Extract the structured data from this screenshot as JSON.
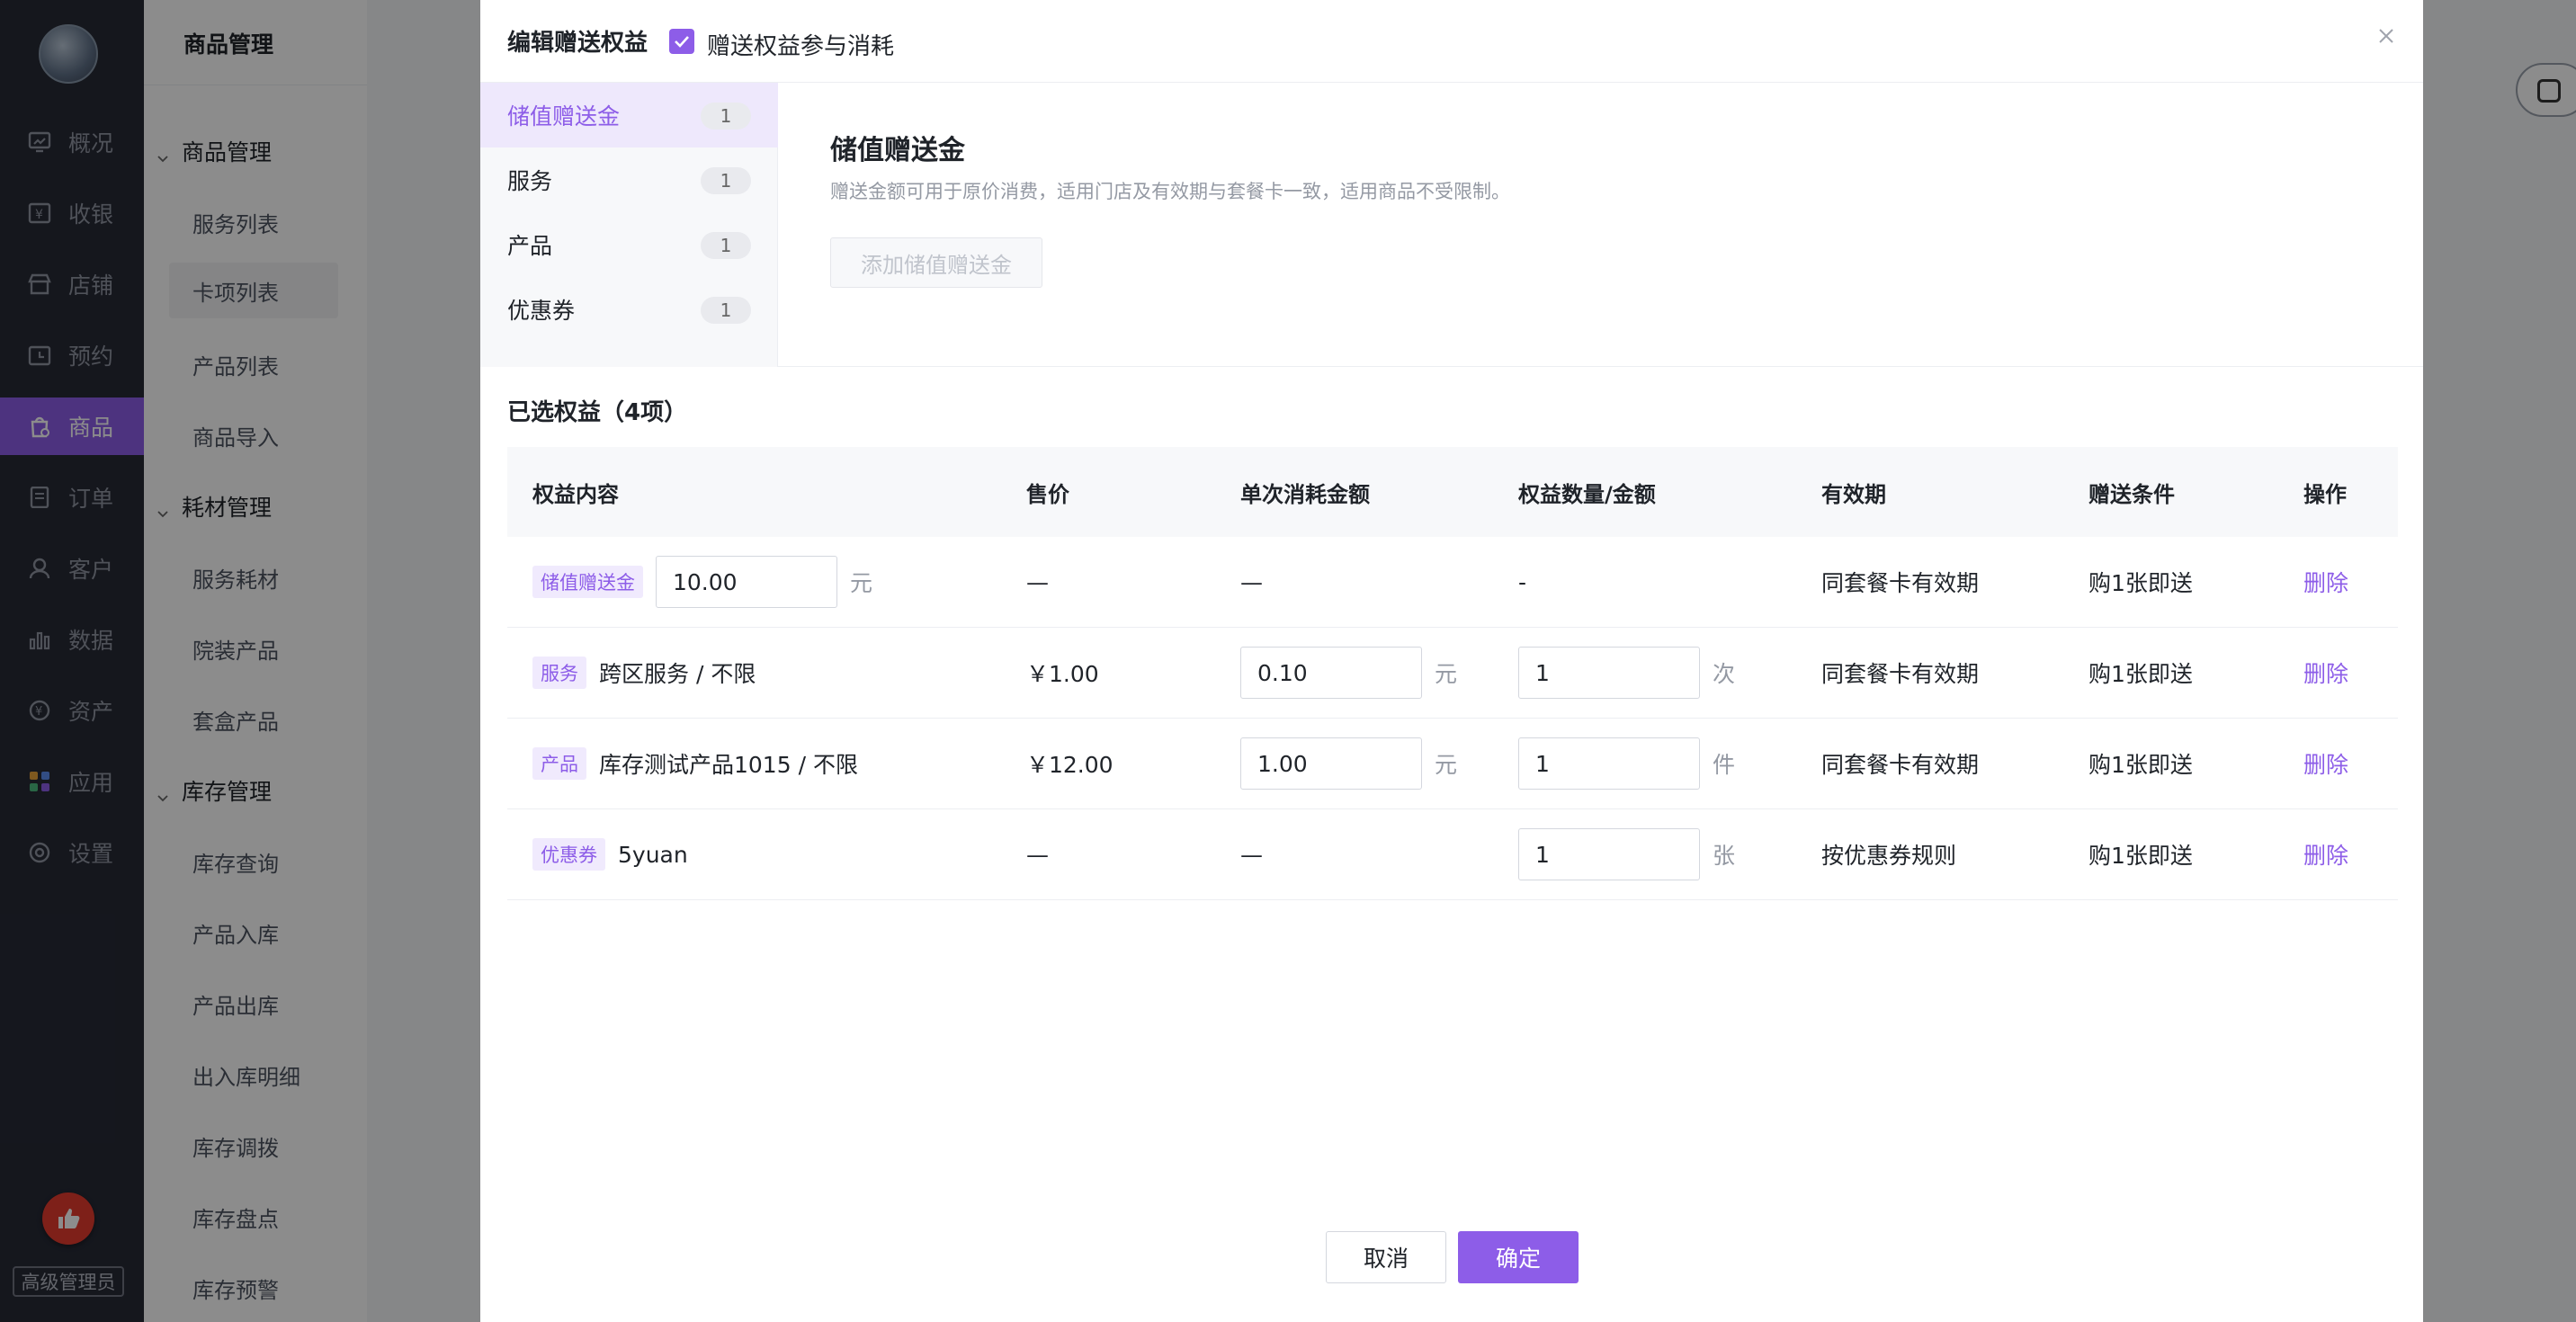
{
  "nav": {
    "items": [
      {
        "label": "概况",
        "icon": "overview-icon"
      },
      {
        "label": "收银",
        "icon": "cashier-icon"
      },
      {
        "label": "店铺",
        "icon": "store-icon"
      },
      {
        "label": "预约",
        "icon": "appointment-icon"
      },
      {
        "label": "商品",
        "icon": "goods-icon",
        "active": true
      },
      {
        "label": "订单",
        "icon": "order-icon"
      },
      {
        "label": "客户",
        "icon": "customer-icon"
      },
      {
        "label": "数据",
        "icon": "data-icon"
      },
      {
        "label": "资产",
        "icon": "asset-icon"
      },
      {
        "label": "应用",
        "icon": "apps-icon"
      },
      {
        "label": "设置",
        "icon": "settings-icon"
      }
    ],
    "role_badge": "高级管理员"
  },
  "subnav": {
    "title": "商品管理",
    "groups": [
      {
        "label": "商品管理",
        "items": [
          "服务列表",
          "卡项列表",
          "产品列表",
          "商品导入"
        ],
        "selected": "卡项列表"
      },
      {
        "label": "耗材管理",
        "items": [
          "服务耗材",
          "院装产品",
          "套盒产品"
        ]
      },
      {
        "label": "库存管理",
        "items": [
          "库存查询",
          "产品入库",
          "产品出库",
          "出入库明细",
          "库存调拨",
          "库存盘点",
          "库存预警"
        ]
      }
    ]
  },
  "modal": {
    "title": "编辑赠送权益",
    "checkbox_label": "赠送权益参与消耗",
    "checkbox_checked": true,
    "categories": [
      {
        "label": "储值赠送金",
        "count": "1",
        "active": true
      },
      {
        "label": "服务",
        "count": "1"
      },
      {
        "label": "产品",
        "count": "1"
      },
      {
        "label": "优惠券",
        "count": "1"
      }
    ],
    "detail": {
      "title": "储值赠送金",
      "desc": "赠送金额可用于原价消费，适用门店及有效期与套餐卡一致，适用商品不受限制。",
      "add_button": "添加储值赠送金"
    },
    "selected_title": "已选权益（4项）",
    "table": {
      "headers": [
        "权益内容",
        "售价",
        "单次消耗金额",
        "权益数量/金额",
        "有效期",
        "赠送条件",
        "操作"
      ],
      "rows": [
        {
          "tag": "储值赠送金",
          "name": "",
          "amount_input": "10.00",
          "amount_unit": "元",
          "price": "—",
          "per_use": "—",
          "per_use_unit": "",
          "qty": "-",
          "qty_unit": "",
          "validity": "同套餐卡有效期",
          "condition": "购1张即送",
          "action": "删除"
        },
        {
          "tag": "服务",
          "name": "跨区服务 / 不限",
          "amount_input": "",
          "amount_unit": "",
          "price": "￥1.00",
          "per_use": "0.10",
          "per_use_unit": "元",
          "qty": "1",
          "qty_unit": "次",
          "validity": "同套餐卡有效期",
          "condition": "购1张即送",
          "action": "删除"
        },
        {
          "tag": "产品",
          "name": "库存测试产品1015 / 不限",
          "amount_input": "",
          "amount_unit": "",
          "price": "￥12.00",
          "per_use": "1.00",
          "per_use_unit": "元",
          "qty": "1",
          "qty_unit": "件",
          "validity": "同套餐卡有效期",
          "condition": "购1张即送",
          "action": "删除"
        },
        {
          "tag": "优惠券",
          "name": "5yuan",
          "amount_input": "",
          "amount_unit": "",
          "price": "—",
          "per_use": "—",
          "per_use_unit": "",
          "qty": "1",
          "qty_unit": "张",
          "validity": "按优惠券规则",
          "condition": "购1张即送",
          "action": "删除"
        }
      ]
    },
    "cancel_label": "取消",
    "ok_label": "确定"
  }
}
